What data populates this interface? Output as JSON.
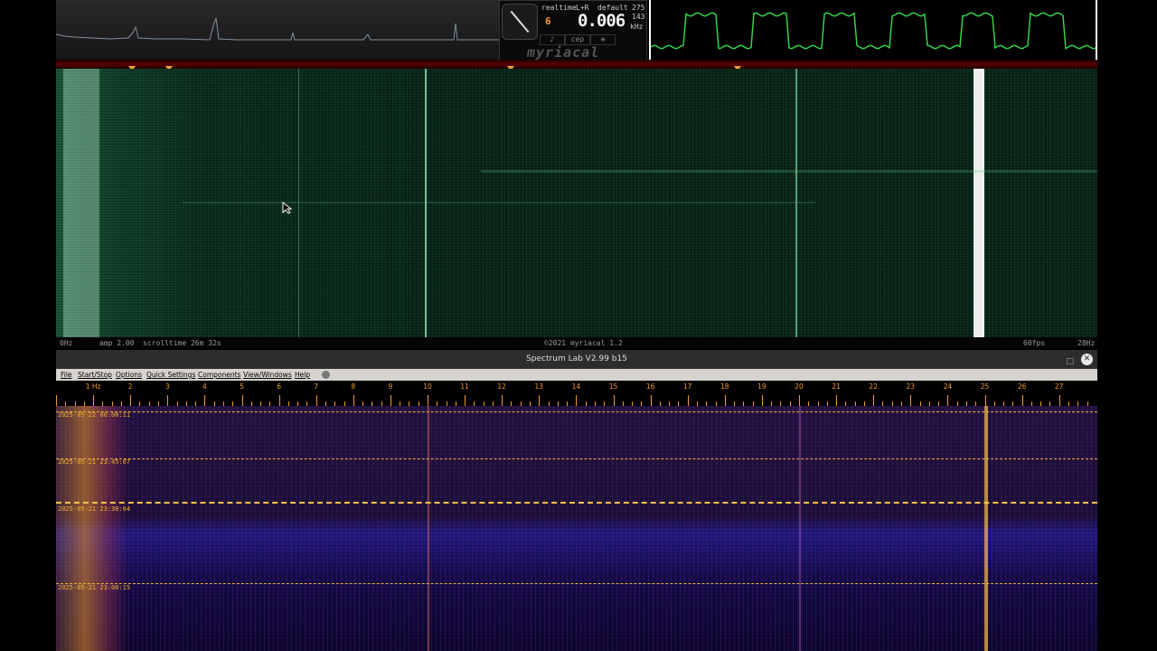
{
  "myriacal": {
    "mode": "realtime",
    "channel": "L+R",
    "preset": "default",
    "readout_main": "0.006",
    "readout_small": "275",
    "readout_small2": "143",
    "unit": "kHz",
    "amber": "6",
    "buttons": [
      "♪",
      "cep",
      "≡"
    ],
    "logo": "myriacal"
  },
  "green_footer": {
    "left": "0Hz",
    "amp": "amp 2.00",
    "scrolltime": "scrolltime 26m 32s",
    "center": "©2021 myriacal 1.2",
    "fps": "60fps",
    "right": "28Hz"
  },
  "window": {
    "title": "Spectrum Lab V2.99 b15",
    "close": "✕",
    "maximize": "□"
  },
  "menu": [
    "File",
    "Start/Stop",
    "Options",
    "Quick Settings",
    "Components",
    "View/Windows",
    "Help"
  ],
  "scale": {
    "labels": [
      "1 Hz",
      "2",
      "3",
      "4",
      "5",
      "6",
      "7",
      "8",
      "9",
      "10",
      "11",
      "12",
      "13",
      "14",
      "15",
      "16",
      "17",
      "18",
      "19",
      "20",
      "21",
      "22",
      "23",
      "24",
      "25",
      "26",
      "27"
    ]
  },
  "timestamps": [
    "2025-05-22 00:00:11",
    "2025-05-21 23:45:07",
    "2025-05-21 23:30:04",
    "2025-05-21 23:00:15"
  ],
  "colors": {
    "accent": "#f39a2a",
    "green_trace": "#32d24a",
    "waterfall_green": "#0a2519",
    "waterfall_purple": "#1d0f3a"
  }
}
